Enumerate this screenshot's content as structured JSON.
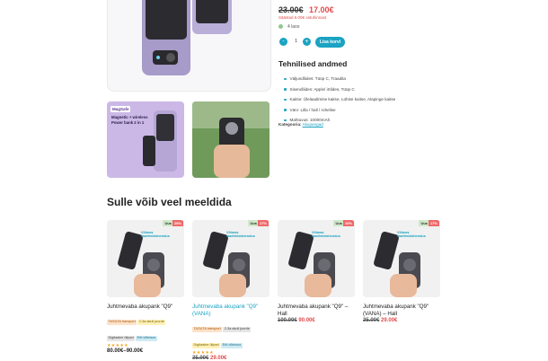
{
  "product": {
    "price_old": "23.00€",
    "price_new": "17.00€",
    "saved_note": "Säästad 6.00€ ostuhinnast",
    "stock": "4 laos",
    "quantity": "1",
    "qty_minus": "-",
    "qty_plus": "+",
    "add_to_cart": "Lisa korvi",
    "specs_title": "Tehnilised andmed",
    "specs": [
      "Väljundliides: Tüüp C, Traadita",
      "Sisendliides: Apple/ iSlides, Tüüp C",
      "Kaitse: Ülelaadimise kaitse, Lühise kaitse, Alapinge kaitse",
      "Värv: Lilla / hall / rohelise",
      "Mahtuvus: 10000mAh"
    ],
    "category_label": "Kategooria:",
    "category_link": "Akupangad",
    "thumb1": {
      "brand": "MagSafe",
      "headline": "Magnetic + wireless Power bank 2 in 1"
    }
  },
  "related": {
    "title": "Sulle võib veel meeldida",
    "items": [
      {
        "badge_new": "Uus",
        "badge_sale": "26%",
        "title": "Juhtmevaba akupank \"Q9\"",
        "link": false,
        "tags": [
          [
            "o",
            "TASUTA transport"
          ],
          [
            "y",
            "2-3a akuil juurde"
          ],
          [
            "g",
            "Digitaalne ülipad"
          ],
          [
            "b",
            "Erit võimsus"
          ]
        ],
        "stars": "★★★★★",
        "price_old": "",
        "price_new": "",
        "price_range": "80.00€–90.00€"
      },
      {
        "badge_new": "Uus",
        "badge_sale": "17%",
        "title": "Juhtmevaba akupank \"Q9\" (VANA)",
        "link": true,
        "tags": [
          [
            "o",
            "TASUTA transport"
          ],
          [
            "g",
            "2-3a akuil juurde"
          ],
          [
            "y",
            "Digitaalne ülipad"
          ],
          [
            "b",
            "Erit võimsus"
          ]
        ],
        "stars": "★★★★★",
        "price_old": "35.00€",
        "price_new": "29.00€",
        "price_range": ""
      },
      {
        "badge_new": "Uus",
        "badge_sale": "10%",
        "title": "Juhtmevaba akupank \"Q9\" – Hall",
        "link": false,
        "tags": [],
        "stars": "",
        "price_old": "100.00€",
        "price_new": "90.00€",
        "price_range": ""
      },
      {
        "badge_new": "Uus",
        "badge_sale": "17%",
        "title": "Juhtmevaba akupank \"Q9\" (VANA) – Hall",
        "link": false,
        "tags": [],
        "stars": "",
        "price_old": "35.00€",
        "price_new": "29.00€",
        "price_range": ""
      }
    ],
    "card_headline": "Võimas laadimislahendus"
  }
}
